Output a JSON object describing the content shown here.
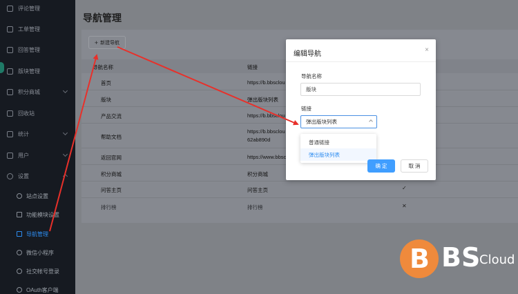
{
  "sidebar": {
    "items": [
      {
        "label": "评论管理",
        "icon": "comment-icon"
      },
      {
        "label": "工单管理",
        "icon": "ticket-icon"
      },
      {
        "label": "回答管理",
        "icon": "answer-icon"
      },
      {
        "label": "版块管理",
        "icon": "board-icon"
      },
      {
        "label": "积分商城",
        "icon": "points-icon"
      },
      {
        "label": "回收站",
        "icon": "trash-icon"
      },
      {
        "label": "统计",
        "icon": "stats-icon"
      },
      {
        "label": "用户",
        "icon": "user-icon"
      },
      {
        "label": "设置",
        "icon": "gear-icon"
      }
    ],
    "sub_items": [
      {
        "label": "站点设置",
        "icon": "site-icon"
      },
      {
        "label": "功能模块设置",
        "icon": "module-icon"
      },
      {
        "label": "导航管理",
        "icon": "nav-icon",
        "active": true
      },
      {
        "label": "微信小程序",
        "icon": "wechat-icon"
      },
      {
        "label": "社交帐号登录",
        "icon": "social-icon"
      },
      {
        "label": "OAuth客户端",
        "icon": "oauth-icon"
      }
    ]
  },
  "page": {
    "title": "导航管理"
  },
  "toolbar": {
    "new_label": "新建导航",
    "new_icon": "plus-icon"
  },
  "table": {
    "columns": [
      "导航名称",
      "链接"
    ],
    "rows": [
      {
        "name": "首页",
        "link": "https://b.bbsclou",
        "mark": ""
      },
      {
        "name": "版块",
        "link": "弹出版块列表",
        "mark": ""
      },
      {
        "name": "产品交流",
        "link": "https://b.bbsclou",
        "mark": ""
      },
      {
        "name": "帮助文档",
        "link": "https://b.bbsclou",
        "link2": "62ab890d",
        "mark": ""
      },
      {
        "name": "返回官网",
        "link": "https://www.bbsc",
        "mark": ""
      },
      {
        "name": "积分商城",
        "link": "积分商城",
        "mark": ""
      },
      {
        "name": "问答主页",
        "link": "问答主页",
        "mark": "✓"
      },
      {
        "name": "排行榜",
        "link": "排行榜",
        "mark": "✕"
      }
    ]
  },
  "modal": {
    "title": "编辑导航",
    "close": "×",
    "name_label": "导航名称",
    "name_value": "版块",
    "link_label": "链接",
    "link_value": "弹出版块列表",
    "options": [
      "普通链接",
      "弹出版块列表"
    ],
    "ok_label": "确 定",
    "cancel_label": "取 消"
  },
  "logo": {
    "b": "B",
    "bs": "BS",
    "cloud": "Cloud"
  },
  "colors": {
    "accent": "#409eff",
    "arrow": "#e8302a",
    "logo": "#ef8a3c",
    "sidebar": "#161a21"
  }
}
